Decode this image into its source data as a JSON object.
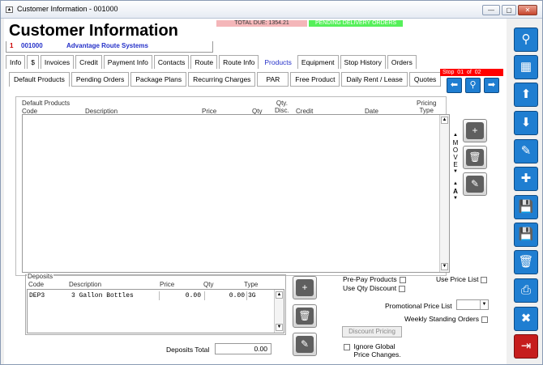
{
  "window": {
    "title": "Customer Information - 001000"
  },
  "banner": {
    "total_due": "TOTAL DUE:  1354.21",
    "pending": "PENDING DELIVERY ORDERS"
  },
  "page_title": "Customer Information",
  "customer": {
    "flag": "1",
    "number": "001000",
    "name": "Advantage Route Systems"
  },
  "tabs": [
    "Info",
    "$",
    "Invoices",
    "Credit",
    "Payment Info",
    "Contacts",
    "Route",
    "Route Info",
    "Products",
    "Equipment",
    "Stop History",
    "Orders"
  ],
  "subtabs": [
    "Default Products",
    "Pending Orders",
    "Package Plans",
    "Recurring Charges",
    "PAR",
    "Free Product",
    "Daily Rent / Lease",
    "Quotes"
  ],
  "stop": {
    "label": "Stop",
    "current": "01",
    "of": "of",
    "total": "02"
  },
  "products": {
    "group": "Default Products",
    "headers": {
      "code": "Code",
      "description": "Description",
      "price": "Price",
      "qty": "Qty",
      "qty_disc": "Qty.\nDisc.",
      "credit": "Credit",
      "date": "Date",
      "pricing_type": "Pricing\nType"
    },
    "move_label": "M\nO\nV\nE"
  },
  "deposits": {
    "group": "Deposits",
    "headers": {
      "code": "Code",
      "description": "Description",
      "price": "Price",
      "qty": "Qty",
      "type": "Type"
    },
    "rows": [
      {
        "code": "DEP3",
        "description": "3 Gallon Bottles",
        "price": "0.00",
        "qty": "0.00",
        "type": "3G"
      }
    ],
    "total_label": "Deposits Total",
    "total_value": "0.00"
  },
  "options": {
    "prepay": "Pre-Pay Products",
    "qty_discount": "Use Qty Discount",
    "price_list": "Use Price List",
    "promo_price_list": "Promotional Price List",
    "weekly_orders": "Weekly Standing Orders",
    "discount_pricing": "Discount Pricing",
    "ignore_global": "Ignore Global\nPrice Changes."
  },
  "icons": [
    "search-icon",
    "grid-icon",
    "arrow-up-icon",
    "arrow-down-icon",
    "edit-icon",
    "add-icon",
    "save-new-icon",
    "save-icon",
    "delete-icon",
    "print-icon",
    "close-icon",
    "exit-icon"
  ]
}
